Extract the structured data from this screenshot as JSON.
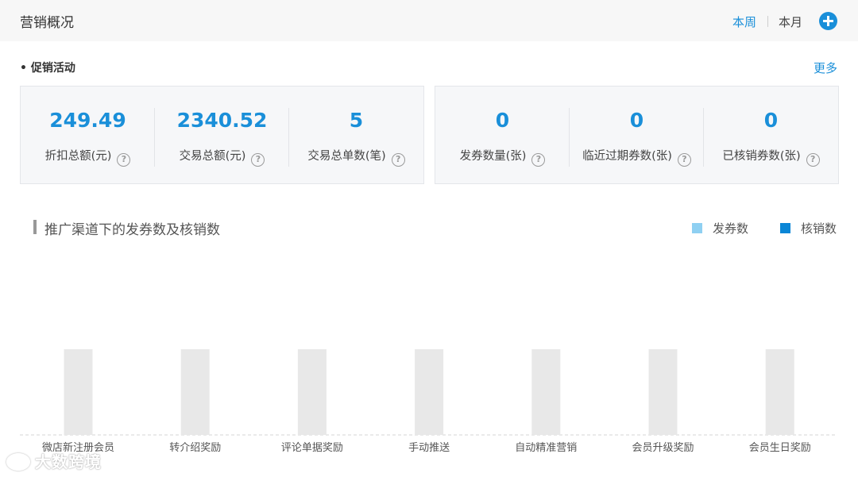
{
  "header": {
    "title": "营销概况",
    "period_week": "本周",
    "period_month": "本月",
    "add_icon": "plus-circle-icon"
  },
  "promotion": {
    "title": "• 促销活动",
    "more": "更多",
    "stats": [
      {
        "value": "249.49",
        "label": "折扣总额(元)"
      },
      {
        "value": "2340.52",
        "label": "交易总额(元)"
      },
      {
        "value": "5",
        "label": "交易总单数(笔)"
      },
      {
        "value": "0",
        "label": "发券数量(张)"
      },
      {
        "value": "0",
        "label": "临近过期券数(张)"
      },
      {
        "value": "0",
        "label": "已核销券数(张)"
      }
    ],
    "help_glyph": "?"
  },
  "chart_section": {
    "title": "推广渠道下的发券数及核销数",
    "legend": [
      {
        "name": "发券数",
        "color": "#8fd0f2"
      },
      {
        "name": "核销数",
        "color": "#0a86d6"
      }
    ]
  },
  "chart_data": {
    "type": "bar",
    "title": "推广渠道下的发券数及核销数",
    "categories": [
      "微店新注册会员",
      "转介绍奖励",
      "评论单据奖励",
      "手动推送",
      "自动精准营销",
      "会员升级奖励",
      "会员生日奖励"
    ],
    "series": [
      {
        "name": "发券数",
        "values": [
          0,
          0,
          0,
          0,
          0,
          0,
          0
        ],
        "color": "#8fd0f2"
      },
      {
        "name": "核销数",
        "values": [
          0,
          0,
          0,
          0,
          0,
          0,
          0
        ],
        "color": "#0a86d6"
      }
    ],
    "placeholder_bar_color": "#e8e8e8",
    "grid": false,
    "legend_position": "top-right"
  },
  "watermark": "大数跨境"
}
